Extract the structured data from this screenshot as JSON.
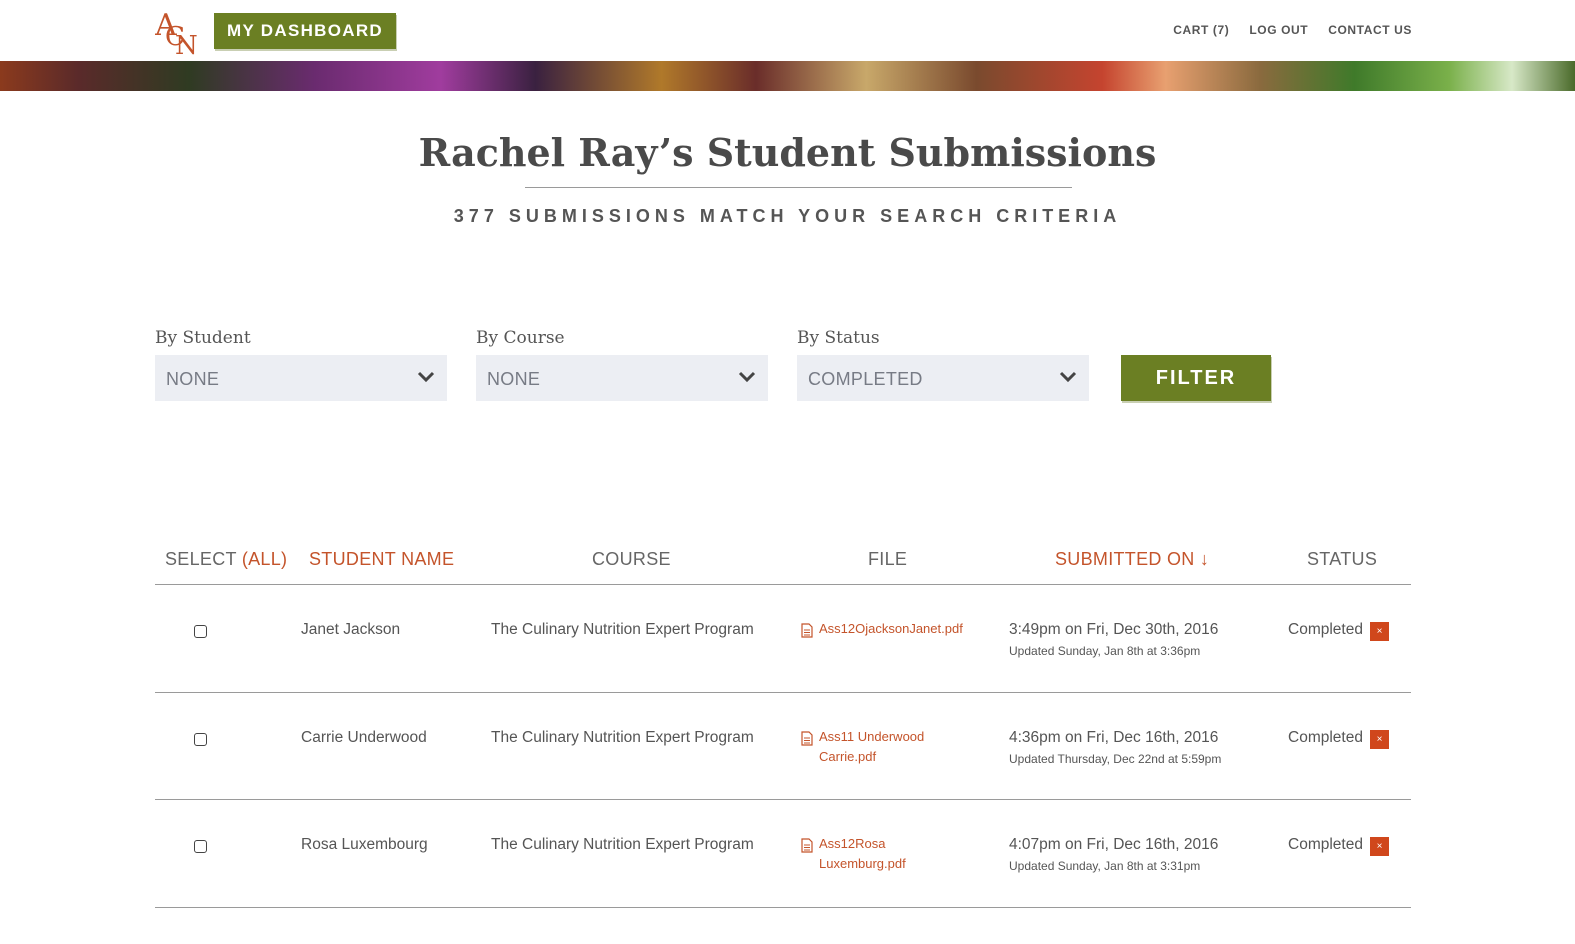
{
  "header": {
    "logo_text": "ACN",
    "dashboard_label": "MY DASHBOARD",
    "nav": [
      "CART (7)",
      "LOG OUT",
      "CONTACT US"
    ]
  },
  "page": {
    "title": "Rachel Ray’s Student Submissions",
    "subtitle": "377 SUBMISSIONS MATCH YOUR SEARCH CRITERIA"
  },
  "filters": {
    "student": {
      "label": "By Student",
      "value": "NONE"
    },
    "course": {
      "label": "By Course",
      "value": "NONE"
    },
    "status": {
      "label": "By Status",
      "value": "COMPLETED"
    },
    "button_label": "FILTER"
  },
  "table": {
    "headers": {
      "select": "SELECT",
      "select_all": "(ALL)",
      "student_name": "STUDENT NAME",
      "course": "COURSE",
      "file": "FILE",
      "submitted_on": "SUBMITTED ON ↓",
      "status": "STATUS"
    },
    "rows": [
      {
        "student": "Janet Jackson",
        "course": "The Culinary Nutrition Expert Program",
        "file_line1": "Ass12OjacksonJanet.pdf",
        "file_line2": "",
        "submitted": "3:49pm on Fri, Dec 30th, 2016",
        "updated": "Updated Sunday, Jan 8th at 3:36pm",
        "status": "Completed",
        "remove": "×"
      },
      {
        "student": "Carrie Underwood",
        "course": "The Culinary Nutrition Expert Program",
        "file_line1": "Ass11 Underwood",
        "file_line2": "Carrie.pdf",
        "submitted": "4:36pm on Fri, Dec 16th, 2016",
        "updated": "Updated Thursday, Dec 22nd at 5:59pm",
        "status": "Completed",
        "remove": "×"
      },
      {
        "student": "Rosa Luxembourg",
        "course": "The Culinary Nutrition Expert Program",
        "file_line1": "Ass12Rosa Luxemburg.pdf",
        "file_line2": "",
        "submitted": "4:07pm on Fri, Dec 16th, 2016",
        "updated": "Updated Sunday, Jan 8th at 3:31pm",
        "status": "Completed",
        "remove": "×"
      }
    ]
  },
  "colors": {
    "accent_green": "#6b7f23",
    "accent_orange": "#c4542b",
    "status_remove": "#d0471c"
  }
}
